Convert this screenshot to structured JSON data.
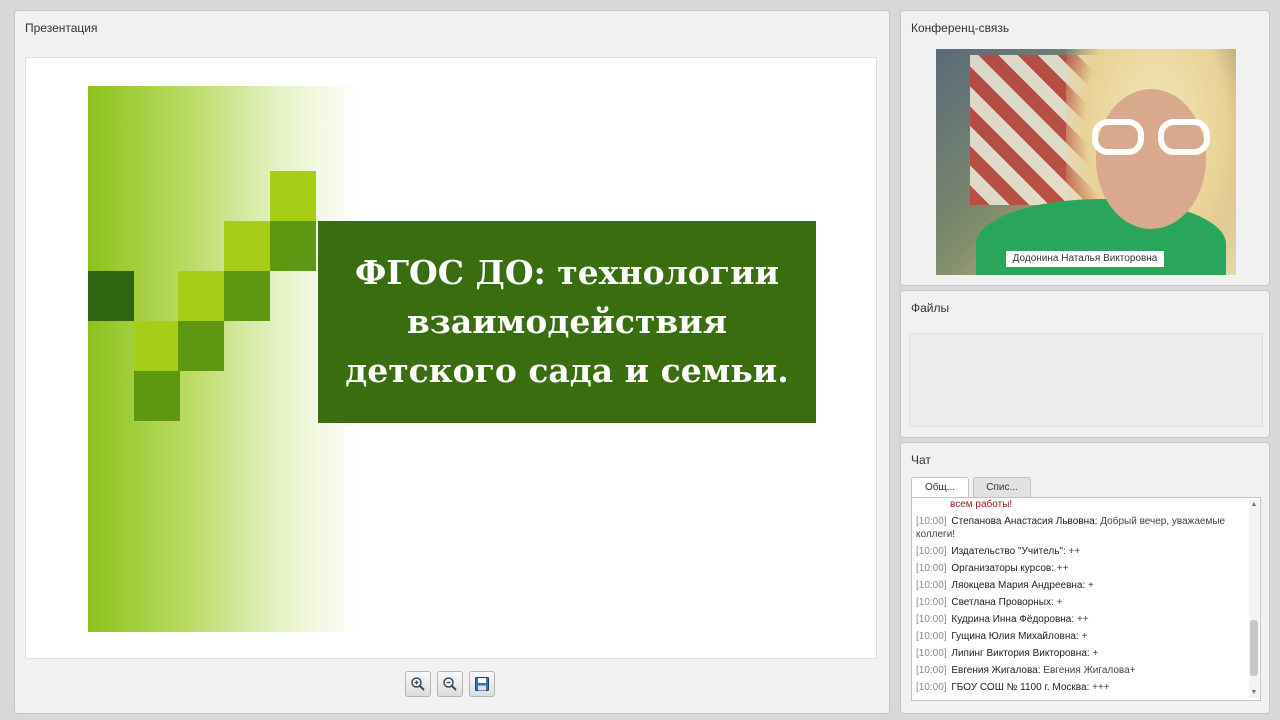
{
  "presentation": {
    "title": "Презентация",
    "slide_title": "ФГОС ДО: технологии взаимодействия детского сада и семьи.",
    "tools": [
      {
        "icon": "zoom-in-icon"
      },
      {
        "icon": "zoom-out-icon"
      },
      {
        "icon": "save-icon"
      }
    ],
    "colors": {
      "accent_dark": "#3a6d10",
      "accent_light": "#8dc21d"
    }
  },
  "conference": {
    "title": "Конференц-связь",
    "participant_name": "Додонина Наталья Викторовна"
  },
  "files": {
    "title": "Файлы"
  },
  "chat": {
    "title": "Чат",
    "tabs": [
      {
        "label": "Общ...",
        "active": true
      },
      {
        "label": "Спис...",
        "active": false
      }
    ],
    "messages": [
      {
        "time": "",
        "name": "",
        "text": "всем работы!"
      },
      {
        "time": "[10:00]",
        "name": "Степанова Анастасия Львовна:",
        "text": "Добрый вечер, уважаемые коллеги!"
      },
      {
        "time": "[10:00]",
        "name": "Издательство \"Учитель\":",
        "text": "++"
      },
      {
        "time": "[10:00]",
        "name": "Организаторы курсов:",
        "text": "++"
      },
      {
        "time": "[10:00]",
        "name": "Ляокцева Мария Андреевна:",
        "text": "+"
      },
      {
        "time": "[10:00]",
        "name": "Светлана Проворных:",
        "text": "+"
      },
      {
        "time": "[10:00]",
        "name": "Кудрина Инна Фёдоровна:",
        "text": "++"
      },
      {
        "time": "[10:00]",
        "name": "Гущина Юлия Михайловна:",
        "text": "+"
      },
      {
        "time": "[10:00]",
        "name": "Липинг Виктория Викторовна:",
        "text": "+"
      },
      {
        "time": "[10:00]",
        "name": "Евгения Жигалова:",
        "text": "Евгения Жигалова+"
      },
      {
        "time": "[10:00]",
        "name": "ГБОУ СОШ № 1100 г. Москва:",
        "text": "+++"
      }
    ]
  }
}
